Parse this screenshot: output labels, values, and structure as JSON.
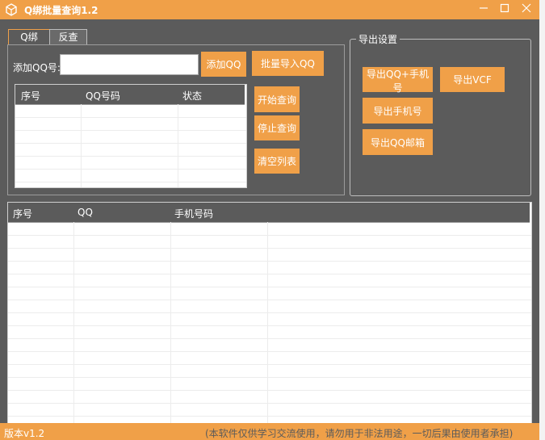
{
  "window": {
    "title": "Q绑批量查询1.2"
  },
  "tabs": [
    {
      "label": "Q绑"
    },
    {
      "label": "反查"
    }
  ],
  "form": {
    "add_label": "添加QQ号:",
    "qq_input": {
      "value": "",
      "placeholder": ""
    },
    "add_qq_button": "添加QQ",
    "batch_import_button": "批量导入QQ"
  },
  "top_table": {
    "columns": [
      "序号",
      "QQ号码",
      "状态"
    ],
    "rows": []
  },
  "actions": {
    "start": "开始查询",
    "stop": "停止查询",
    "clear": "清空列表"
  },
  "export": {
    "title": "导出设置",
    "qq_phone": "导出QQ+手机号",
    "vcf": "导出VCF",
    "phone": "导出手机号",
    "qq_mail": "导出QQ邮箱"
  },
  "bottom_table": {
    "columns": [
      "序号",
      "QQ",
      "手机号码"
    ],
    "rows": []
  },
  "status": {
    "version": "版本v1.2",
    "notice": "(本软件仅供学习交流使用，请勿用于非法用途，一切后果由使用者承担)"
  },
  "colors": {
    "accent": "#f0a048",
    "background": "#5b5b5b"
  }
}
